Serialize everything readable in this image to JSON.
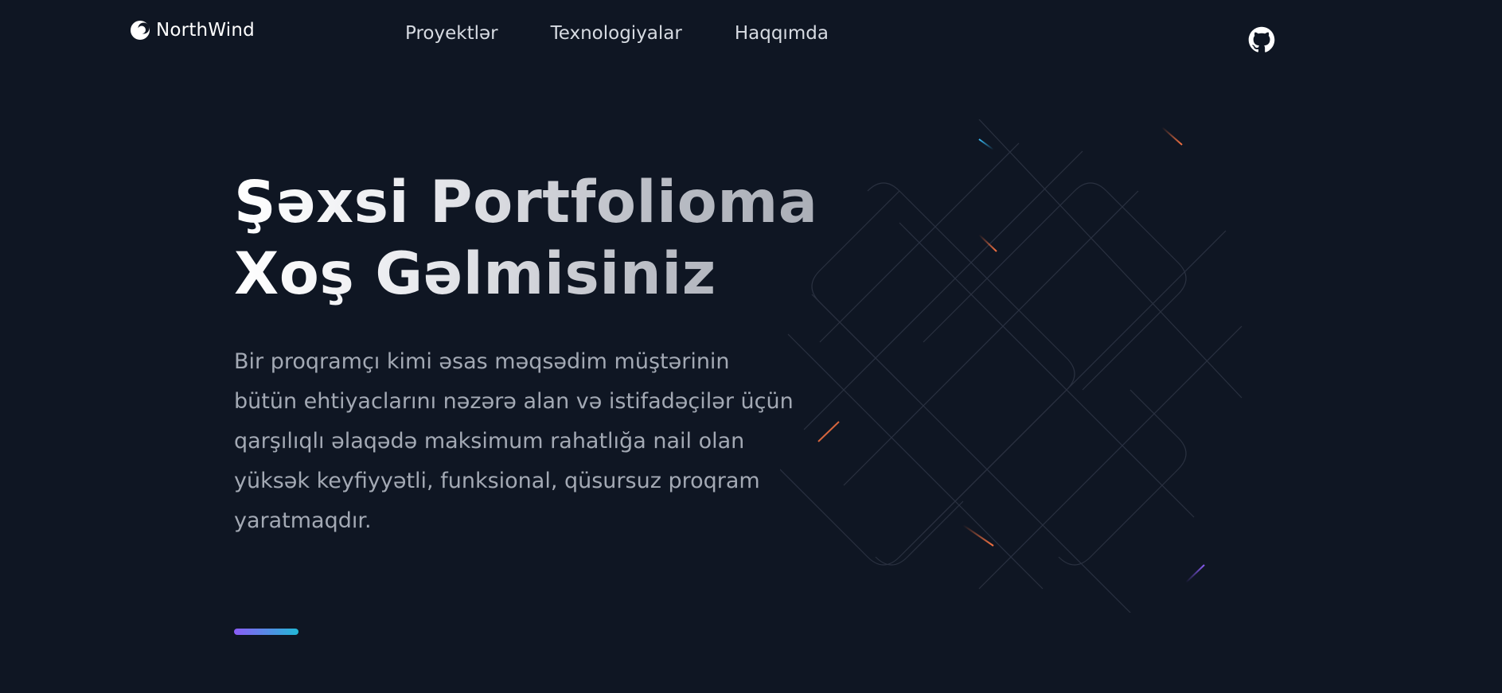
{
  "brand": {
    "name": "NorthWind"
  },
  "nav": {
    "items": [
      {
        "label": "Proyektlər"
      },
      {
        "label": "Texnologiyalar"
      },
      {
        "label": "Haqqımda"
      }
    ]
  },
  "hero": {
    "title_line1": "Şəxsi Portfolioma",
    "title_line2": "Xoş Gəlmisiniz",
    "description": "Bir proqramçı kimi əsas məqsədim müştərinin bütün ehtiyaclarını nəzərə alan və istifadəçilər üçün qarşılıqlı əlaqədə maksimum rahatlığa nail olan yüksək keyfiyyətli, funksional, qüsursuz proqram yaratmaqdır."
  },
  "icons": {
    "brand": "northwind-logo-icon",
    "github": "github-icon"
  },
  "colors": {
    "background": "#0f1623",
    "accent_start": "#8b5cf6",
    "accent_end": "#22b8d6",
    "spark_orange": "#f97342",
    "spark_blue": "#38bdf8"
  }
}
